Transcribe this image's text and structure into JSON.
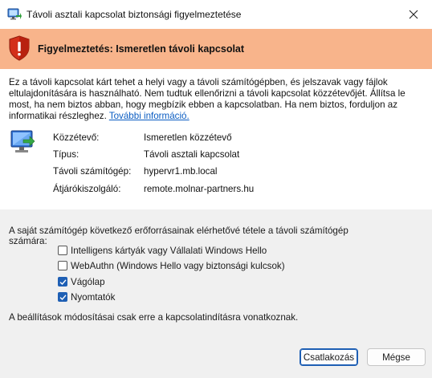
{
  "window": {
    "title": "Távoli asztali kapcsolat biztonsági figyelmeztetése",
    "close_icon": "close-icon",
    "app_icon": "remote-desktop-icon"
  },
  "banner": {
    "heading": "Figyelmeztetés: Ismeretlen távoli kapcsolat",
    "icon": "warning-shield-icon",
    "color": "#f8b48b"
  },
  "description": {
    "text": "Ez a távoli kapcsolat kárt tehet a helyi vagy a távoli számítógépben, és jelszavak vagy fájlok eltulajdonítására is használható. Nem tudtuk ellenőrizni a távoli kapcsolat közzétevőjét. Állítsa le most, ha nem biztos abban, hogy megbízik ebben a kapcsolatban. Ha nem biztos, forduljon az informatikai részleghez.",
    "link": "További információ."
  },
  "details": {
    "publisher_label": "Közzétevő:",
    "publisher_value": "Ismeretlen közzétevő",
    "type_label": "Típus:",
    "type_value": "Távoli asztali kapcsolat",
    "remote_label": "Távoli számítógép:",
    "remote_value": "hypervr1.mb.local",
    "gateway_label": "Átjárókiszolgáló:",
    "gateway_value": "remote.molnar-partners.hu"
  },
  "resources": {
    "intro": "A saját számítógép következő erőforrásainak elérhetővé tétele a távoli számítógép számára:",
    "items": [
      {
        "label": "Intelligens kártyák vagy Vállalati Windows Hello",
        "checked": false
      },
      {
        "label": "WebAuthn (Windows Hello vagy biztonsági kulcsok)",
        "checked": false
      },
      {
        "label": "Vágólap",
        "checked": true
      },
      {
        "label": "Nyomtatók",
        "checked": true
      }
    ],
    "note": "A beállítások módosításai csak erre a kapcsolatindításra vonatkoznak."
  },
  "buttons": {
    "connect": "Csatlakozás",
    "cancel": "Mégse"
  },
  "colors": {
    "accent": "#1e5fb4",
    "link": "#0a5cc2"
  }
}
